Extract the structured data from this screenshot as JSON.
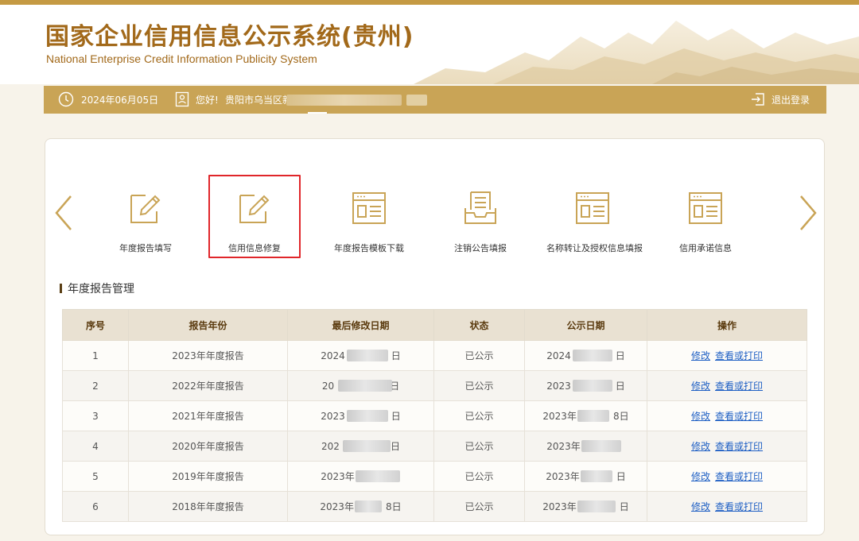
{
  "header": {
    "title": "国家企业信用信息公示系统(贵州)",
    "subtitle": "National Enterprise Credit Information Publicity System"
  },
  "info_bar": {
    "date": "2024年06月05日",
    "greeting": "您好!",
    "company_prefix": "贵阳市乌当区新",
    "logout_label": "退出登录",
    "icons": {
      "date": "clock-icon",
      "user": "user-card-icon",
      "logout": "logout-icon"
    }
  },
  "nav": {
    "prev_icon": "chevron-left-icon",
    "next_icon": "chevron-right-icon",
    "items": [
      {
        "label": "年度报告填写",
        "icon": "edit-form-icon",
        "selected": false
      },
      {
        "label": "信用信息修复",
        "icon": "edit-form-icon",
        "selected": true
      },
      {
        "label": "年度报告模板下载",
        "icon": "document-template-icon",
        "selected": false
      },
      {
        "label": "注销公告填报",
        "icon": "notice-tray-icon",
        "selected": false
      },
      {
        "label": "名称转让及授权信息填报",
        "icon": "document-template-icon",
        "selected": false
      },
      {
        "label": "信用承诺信息",
        "icon": "document-template-icon",
        "selected": false
      }
    ]
  },
  "section": {
    "title": "年度报告管理"
  },
  "table": {
    "headers": [
      "序号",
      "报告年份",
      "最后修改日期",
      "状态",
      "公示日期",
      "操作"
    ],
    "rows": [
      {
        "index": "1",
        "year": "2023年年度报告",
        "modified": "2024",
        "modified_tail": "日",
        "status": "已公示",
        "published": "2024",
        "published_tail": "日"
      },
      {
        "index": "2",
        "year": "2022年年度报告",
        "modified": "20",
        "modified_tail": "日",
        "status": "已公示",
        "published": "2023",
        "published_tail": "日"
      },
      {
        "index": "3",
        "year": "2021年年度报告",
        "modified": "2023",
        "modified_tail": "日",
        "status": "已公示",
        "published": "2023年",
        "published_tail": "8日"
      },
      {
        "index": "4",
        "year": "2020年年度报告",
        "modified": "202",
        "modified_tail": "日",
        "status": "已公示",
        "published": "2023年",
        "published_tail": ""
      },
      {
        "index": "5",
        "year": "2019年年度报告",
        "modified": "2023年",
        "modified_tail": "",
        "status": "已公示",
        "published": "2023年",
        "published_tail": "日"
      },
      {
        "index": "6",
        "year": "2018年年度报告",
        "modified": "2023年",
        "modified_tail": "8日",
        "status": "已公示",
        "published": "2023年",
        "published_tail": "日"
      }
    ],
    "actions": {
      "edit": "修改",
      "view_print": "查看或打印"
    }
  },
  "colors": {
    "brand": "#a2691a",
    "bar": "#c9a456",
    "icon": "#c9a456",
    "selected_border": "#e0262a",
    "link": "#1e5fc4"
  }
}
